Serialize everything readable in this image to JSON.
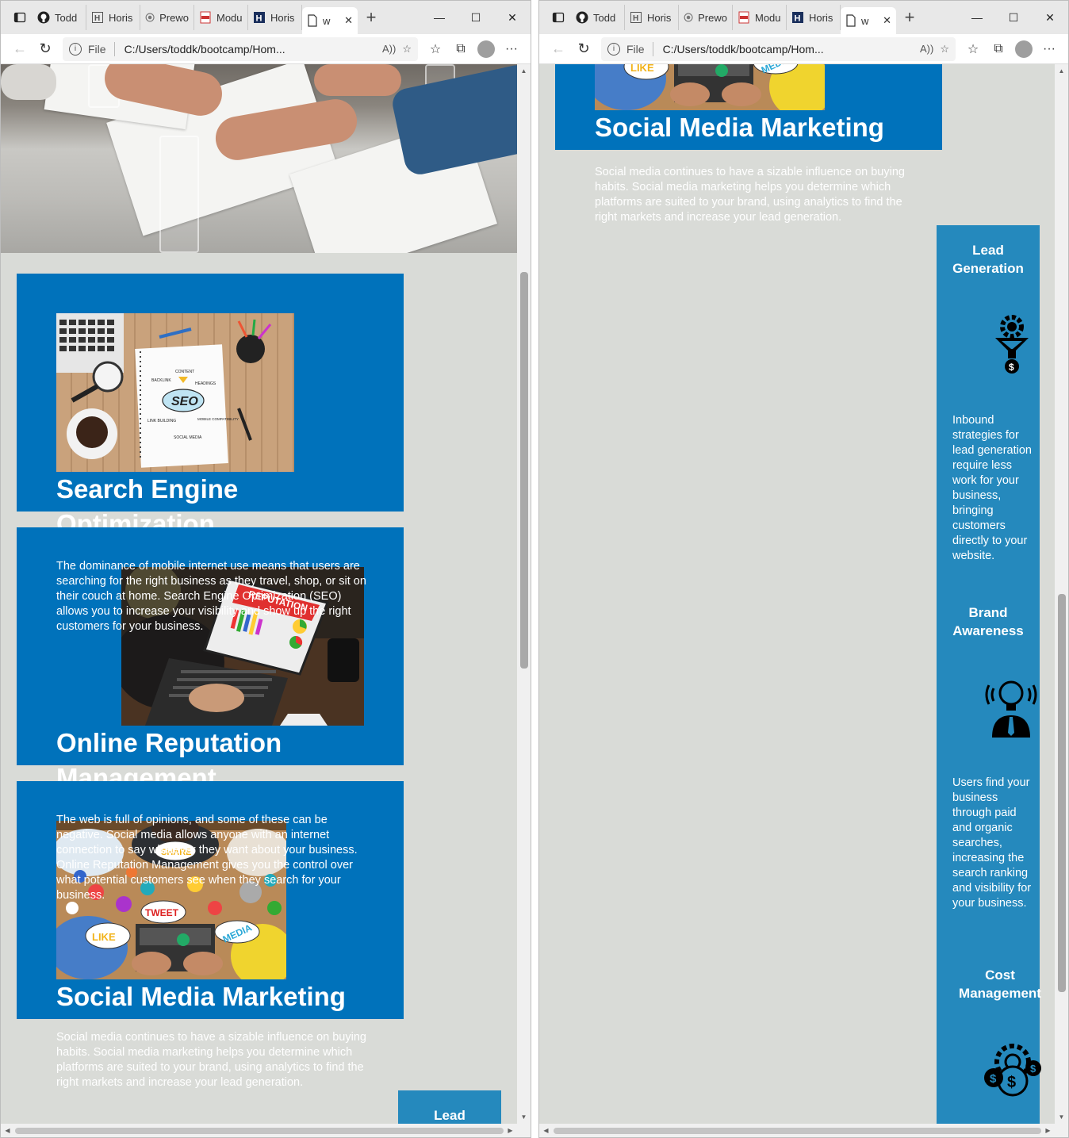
{
  "browser": {
    "tabs": [
      {
        "label": "Todd",
        "icon": "github-icon"
      },
      {
        "label": "Horis",
        "icon": "page-h-icon"
      },
      {
        "label": "Prewo",
        "icon": "circle-icon"
      },
      {
        "label": "Modu",
        "icon": "pdf-icon"
      },
      {
        "label": "Horis",
        "icon": "h-logo-icon"
      },
      {
        "label": "w",
        "icon": "document-icon",
        "active": true
      }
    ],
    "address": {
      "scheme": "File",
      "url": "C:/Users/toddk/bootcamp/Hom..."
    }
  },
  "page": {
    "seo": {
      "title_line1": "Search Engine",
      "title_line2": "Optimization",
      "text": "The dominance of mobile internet use means that users are searching for the right business as they travel, shop, or sit on their couch at home. Search Engine Optimization (SEO) allows you to increase your visibility and show up the right customers for your business.",
      "image_labels": {
        "content": "CONTENT",
        "backlink": "BACKLINK",
        "headings": "HEADINGS",
        "seo": "SEO",
        "link_building": "LINK BUILDING",
        "mobile": "MOBILE COMPATIBILITY",
        "social": "SOCIAL MEDIA"
      }
    },
    "orm": {
      "title_line1": "Online Reputation",
      "title_line2": "Management",
      "text": "The web is full of opinions, and some of these can be negative. Social media allows anyone with an internet connection to say whatever they want about your business. Online Reputation Management gives you the control over what potential customers see when they search for your business.",
      "image_banner": "REPUTATION"
    },
    "smm": {
      "title": "Social Media Marketing",
      "text": "Social media continues to have a sizable influence on buying habits. Social media marketing helps you determine which platforms are suited to your brand, using analytics to find the right markets and increase your lead generation.",
      "image_labels": {
        "like": "LIKE",
        "tweet": "TWEET",
        "media": "MEDIA",
        "share": "SHARE"
      }
    },
    "benefits": [
      {
        "title_line1": "Lead",
        "title_line2": "Generation",
        "icon": "funnel-dollar-icon",
        "text": "Inbound strategies for lead generation require less work for your business, bringing customers directly to your website."
      },
      {
        "title_line1": "Brand",
        "title_line2": "Awareness",
        "icon": "lightbulb-person-icon",
        "text": "Users find your business through paid and organic searches, increasing the search ranking and visibility for your business."
      },
      {
        "title_line1": "Cost",
        "title_line2": "Management",
        "icon": "gear-dollar-icon",
        "text": ""
      }
    ]
  }
}
